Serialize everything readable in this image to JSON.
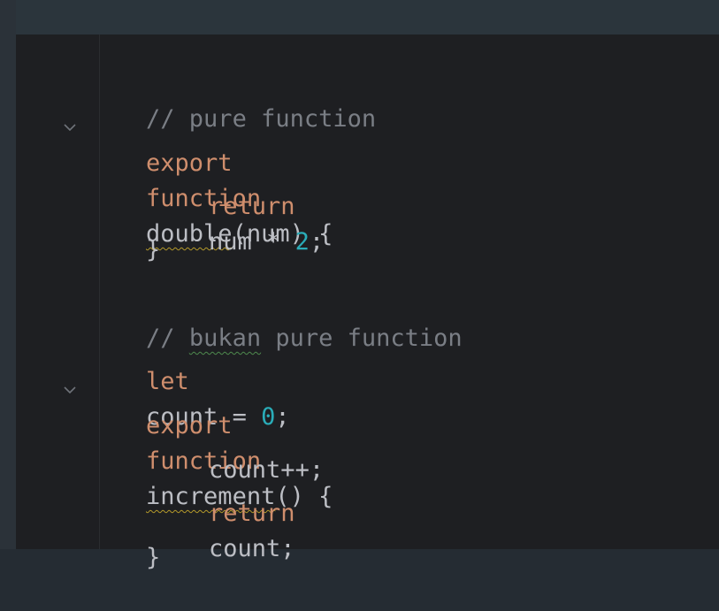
{
  "code": {
    "line1": {
      "comment": "// pure function"
    },
    "line2": {
      "kw_export": "export",
      "kw_function": "function",
      "fn_name": "double",
      "rest": "(num) {"
    },
    "line3": {
      "kw_return": "return",
      "expr": "num * ",
      "num": "2",
      "semi": ";"
    },
    "line4": {
      "brace": "}"
    },
    "line6": {
      "comment_prefix": "// ",
      "comment_typo": "bukan",
      "comment_rest": " pure function"
    },
    "line7": {
      "kw_let": "let",
      "ident": "count = ",
      "num": "0",
      "semi": ";"
    },
    "line8": {
      "kw_export": "export",
      "kw_function": "function",
      "fn_name": "increment",
      "rest": "() {"
    },
    "line9": {
      "stmt": "count++;"
    },
    "line10": {
      "kw_return": "return",
      "expr": "count;"
    },
    "line11": {
      "brace": "}"
    }
  },
  "icons": {
    "fold": "chevron-down-icon"
  },
  "colors": {
    "keyword": "#cf8e6d",
    "comment": "#7a7e85",
    "number": "#2aacb8",
    "text": "#bcbec4",
    "background": "#1e1f22"
  }
}
